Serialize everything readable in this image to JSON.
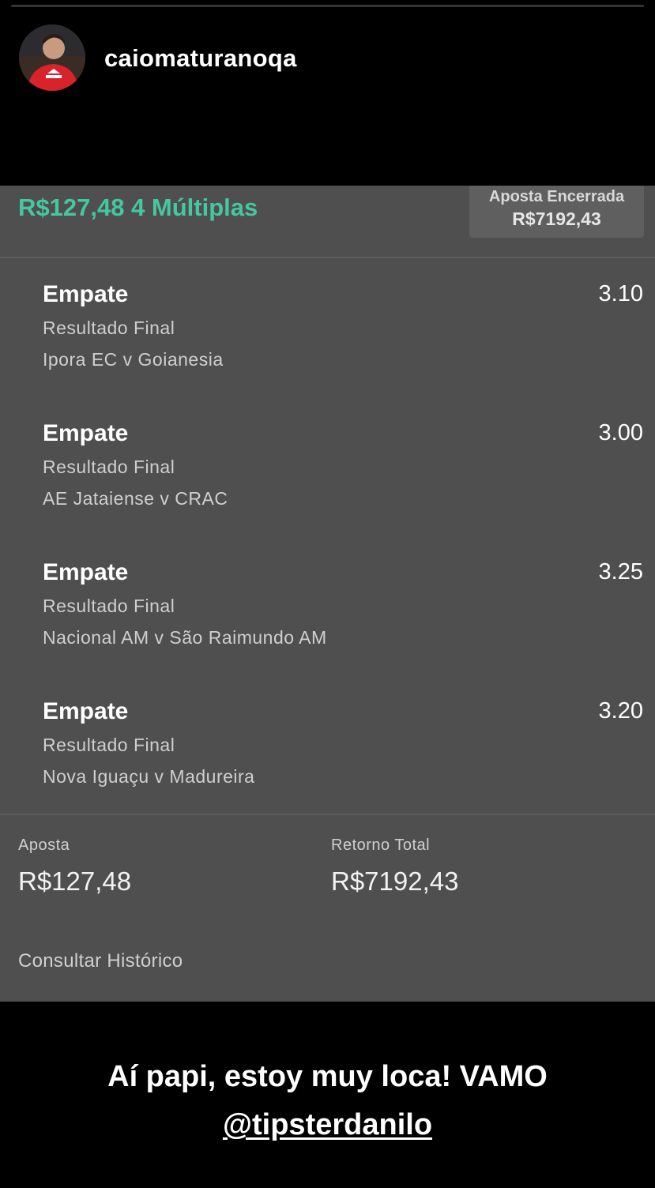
{
  "story": {
    "username": "caiomaturanoqa"
  },
  "bet": {
    "title": "R$127,48 4 Múltiplas",
    "closed_label": "Aposta Encerrada",
    "closed_amount": "R$7192,43",
    "selections": [
      {
        "name": "Empate",
        "odds": "3.10",
        "market": "Resultado Final",
        "event": "Ipora EC v Goianesia"
      },
      {
        "name": "Empate",
        "odds": "3.00",
        "market": "Resultado Final",
        "event": "AE Jataiense v CRAC"
      },
      {
        "name": "Empate",
        "odds": "3.25",
        "market": "Resultado Final",
        "event": "Nacional AM v São Raimundo AM"
      },
      {
        "name": "Empate",
        "odds": "3.20",
        "market": "Resultado Final",
        "event": "Nova Iguaçu v Madureira"
      }
    ],
    "stake_label": "Aposta",
    "stake_value": "R$127,48",
    "return_label": "Retorno Total",
    "return_value": "R$7192,43",
    "history_link": "Consultar Histórico"
  },
  "caption": {
    "line1": "Aí papi, estoy muy loca! VAMO",
    "mention": "@tipsterdanilo"
  },
  "colors": {
    "accent_green": "#45c7a0",
    "card_bg": "#4f4f4f",
    "background": "#000000"
  }
}
